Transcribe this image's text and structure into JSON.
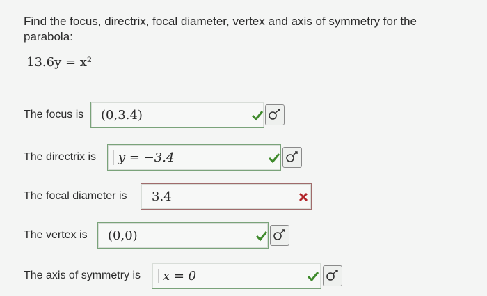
{
  "question": {
    "prompt": "Find the focus, directrix, focal diameter, vertex and axis of symmetry for the parabola:",
    "equation": "13.6y = x²"
  },
  "answers": [
    {
      "label": "The focus is",
      "value": "(0,3.4)",
      "status": "correct",
      "status_icon": "check-icon"
    },
    {
      "label": "The directrix is",
      "value": "y = −3.4",
      "status": "correct",
      "status_icon": "check-icon"
    },
    {
      "label": "The focal diameter is",
      "value": "3.4",
      "status": "incorrect",
      "status_icon": "cross-icon"
    },
    {
      "label": "The vertex is",
      "value": "(0,0)",
      "status": "correct",
      "status_icon": "check-icon"
    },
    {
      "label": "The axis of symmetry is",
      "value": "x = 0",
      "status": "correct",
      "status_icon": "check-icon"
    }
  ],
  "colors": {
    "correct": "#3f8a2c",
    "incorrect": "#b3262b",
    "text": "#2a2a2a"
  },
  "tool_icon": "math-keyboard-icon"
}
